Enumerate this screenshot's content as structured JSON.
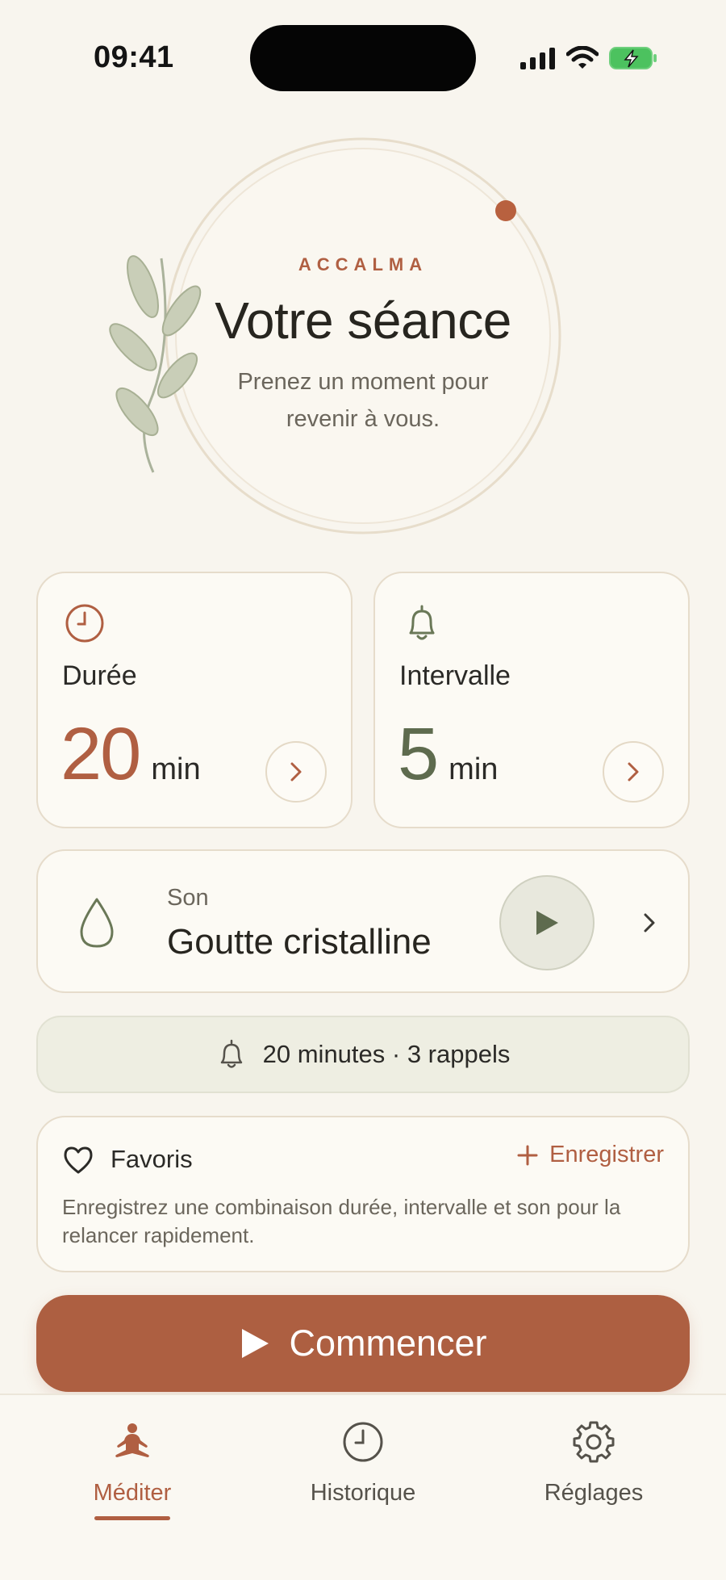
{
  "status_bar": {
    "time": "09:41",
    "icons": [
      "cellular-signal-icon",
      "wifi-icon",
      "battery-charging-icon"
    ]
  },
  "hero": {
    "brand": "ACCALMA",
    "title": "Votre séance",
    "subtitle": "Prenez un moment pour revenir à vous."
  },
  "duration_card": {
    "label": "Durée",
    "value": "20",
    "unit": "min",
    "icon": "clock-icon"
  },
  "interval_card": {
    "label": "Intervalle",
    "value": "5",
    "unit": "min",
    "icon": "bell-icon"
  },
  "sound_card": {
    "caption": "Son",
    "name": "Goutte cristalline",
    "icon": "drop-icon"
  },
  "summary": {
    "text": "20 minutes · 3 rappels"
  },
  "favorites": {
    "title": "Favoris",
    "save_label": "Enregistrer",
    "description": "Enregistrez une combinaison durée, intervalle et son pour la relancer rapidement."
  },
  "start_button": {
    "label": "Commencer"
  },
  "tabbar": {
    "tabs": [
      {
        "label": "Méditer",
        "icon": "meditation-icon",
        "active": true
      },
      {
        "label": "Historique",
        "icon": "history-clock-icon",
        "active": false
      },
      {
        "label": "Réglages",
        "icon": "gear-icon",
        "active": false
      }
    ]
  },
  "colors": {
    "background": "#f8f5ee",
    "accent_terracotta": "#b05f42",
    "accent_sage": "#5e6b4e",
    "card_border": "#e6dccb"
  }
}
